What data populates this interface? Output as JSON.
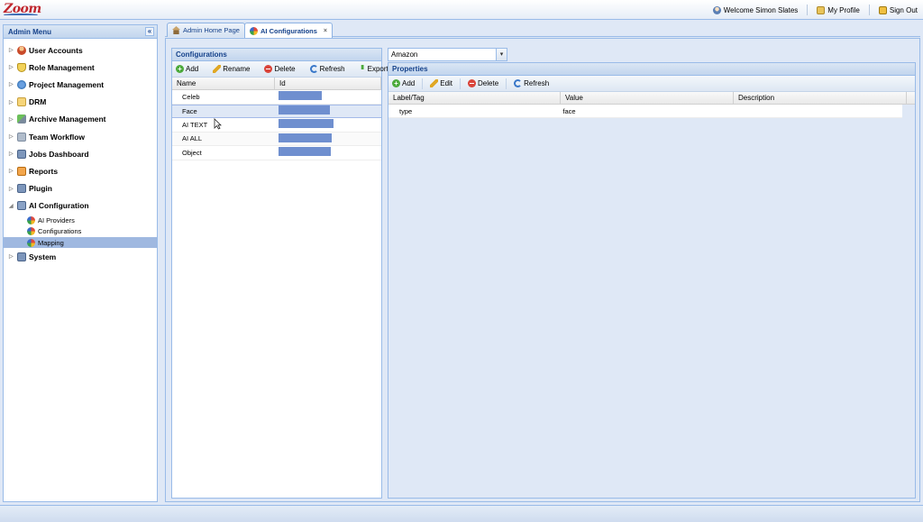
{
  "header": {
    "logo_text": "Zoom",
    "welcome": "Welcome Simon Slates",
    "my_profile": "My Profile",
    "sign_out": "Sign Out"
  },
  "admin_menu": {
    "title": "Admin Menu",
    "collapse_glyph": "«",
    "items": [
      {
        "label": "User Accounts",
        "icon": "user-icon"
      },
      {
        "label": "Role Management",
        "icon": "shield-icon"
      },
      {
        "label": "Project Management",
        "icon": "globe-icon"
      },
      {
        "label": "DRM",
        "icon": "folder-icon"
      },
      {
        "label": "Archive Management",
        "icon": "archive-icon"
      },
      {
        "label": "Team Workflow",
        "icon": "team-icon"
      },
      {
        "label": "Jobs Dashboard",
        "icon": "monitor-icon"
      },
      {
        "label": "Reports",
        "icon": "report-icon"
      },
      {
        "label": "Plugin",
        "icon": "plugin-icon"
      },
      {
        "label": "AI Configuration",
        "icon": "ai-config-icon",
        "expanded": true,
        "children": [
          {
            "label": "AI Providers"
          },
          {
            "label": "Configurations"
          },
          {
            "label": "Mapping",
            "selected": true
          }
        ]
      },
      {
        "label": "System",
        "icon": "system-icon"
      }
    ]
  },
  "tabs": [
    {
      "label": "Admin Home Page",
      "active": false
    },
    {
      "label": "AI Configurations",
      "active": true,
      "close": "×"
    }
  ],
  "configurations": {
    "title": "Configurations",
    "toolbar": {
      "add": "Add",
      "rename": "Rename",
      "delete": "Delete",
      "refresh": "Refresh",
      "export": "Export"
    },
    "columns": {
      "name": "Name",
      "id": "Id"
    },
    "rows": [
      {
        "name": "Celeb",
        "id_redacted": true
      },
      {
        "name": "Face",
        "id_redacted": true,
        "selected": true
      },
      {
        "name": "AI TEXT",
        "id_redacted": true
      },
      {
        "name": "AI ALL",
        "id_redacted": true
      },
      {
        "name": "Object",
        "id_redacted": true
      }
    ]
  },
  "provider_select": {
    "value": "Amazon",
    "arrow": "▾"
  },
  "properties": {
    "title": "Properties",
    "toolbar": {
      "add": "Add",
      "edit": "Edit",
      "delete": "Delete",
      "refresh": "Refresh"
    },
    "columns": {
      "label": "Label/Tag",
      "value": "Value",
      "description": "Description"
    },
    "rows": [
      {
        "label": "type",
        "value": "face",
        "description": ""
      }
    ]
  }
}
